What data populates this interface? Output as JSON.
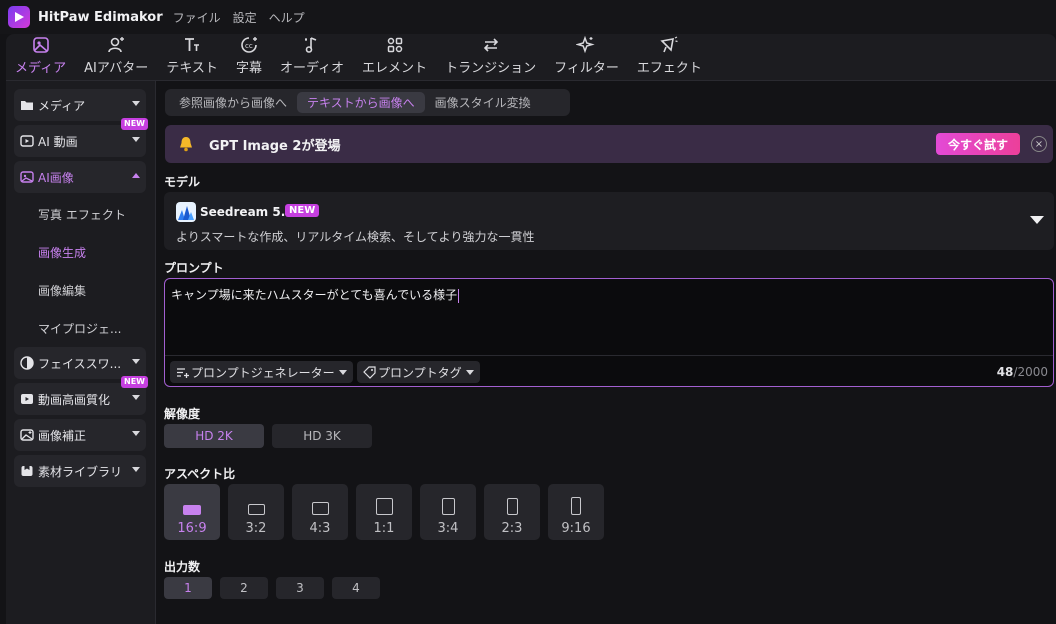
{
  "app": {
    "title": "HitPaw Edimakor"
  },
  "menu": [
    "ファイル",
    "設定",
    "ヘルプ"
  ],
  "toolbar": [
    {
      "label": "メディア",
      "icon": "media-icon",
      "active": true
    },
    {
      "label": "AIアバター",
      "icon": "avatar-icon"
    },
    {
      "label": "テキスト",
      "icon": "text-icon"
    },
    {
      "label": "字幕",
      "icon": "subtitle-icon"
    },
    {
      "label": "オーディオ",
      "icon": "audio-icon"
    },
    {
      "label": "エレメント",
      "icon": "element-icon"
    },
    {
      "label": "トランジション",
      "icon": "transition-icon"
    },
    {
      "label": "フィルター",
      "icon": "filter-icon"
    },
    {
      "label": "エフェクト",
      "icon": "effect-icon"
    }
  ],
  "sidebar": {
    "items": [
      {
        "label": "メディア"
      },
      {
        "label": "AI 動画",
        "badge": "NEW"
      },
      {
        "label": "AI画像"
      },
      {
        "label": "フェイススワ..."
      },
      {
        "label": "動画高画質化",
        "badge": "NEW"
      },
      {
        "label": "画像補正"
      },
      {
        "label": "素材ライブラリ"
      }
    ],
    "subitems": [
      {
        "label": "写真 エフェクト"
      },
      {
        "label": "画像生成"
      },
      {
        "label": "画像編集"
      },
      {
        "label": "マイプロジェ..."
      }
    ]
  },
  "tabs": [
    {
      "label": "参照画像から画像へ"
    },
    {
      "label": "テキストから画像へ"
    },
    {
      "label": "画像スタイル変換"
    }
  ],
  "banner": {
    "text": "GPT Image 2が登場",
    "cta": "今すぐ試す",
    "close": "×"
  },
  "model": {
    "section": "モデル",
    "name": "Seedream 5.0",
    "badge": "NEW",
    "description": "よりスマートな作成、リアルタイム検索、そしてより強力な一貫性"
  },
  "prompt": {
    "section": "プロンプト",
    "text": "キャンプ場に来たハムスターがとても喜んでいる様子",
    "generator": "プロンプトジェネレーター",
    "tags": "プロンプトタグ",
    "count": "48",
    "max": "/2000"
  },
  "resolution": {
    "section": "解像度",
    "options": [
      "HD 2K",
      "HD 3K"
    ],
    "selected": 0
  },
  "aspect": {
    "section": "アスペクト比",
    "options": [
      "16:9",
      "3:2",
      "4:3",
      "1:1",
      "3:4",
      "2:3",
      "9:16"
    ],
    "selected": 0
  },
  "output": {
    "section": "出力数",
    "options": [
      "1",
      "2",
      "3",
      "4"
    ],
    "selected": 0
  },
  "colors": {
    "accent": "#c781ee",
    "badge": "#c63fe0",
    "cta": "#e34ad6"
  }
}
